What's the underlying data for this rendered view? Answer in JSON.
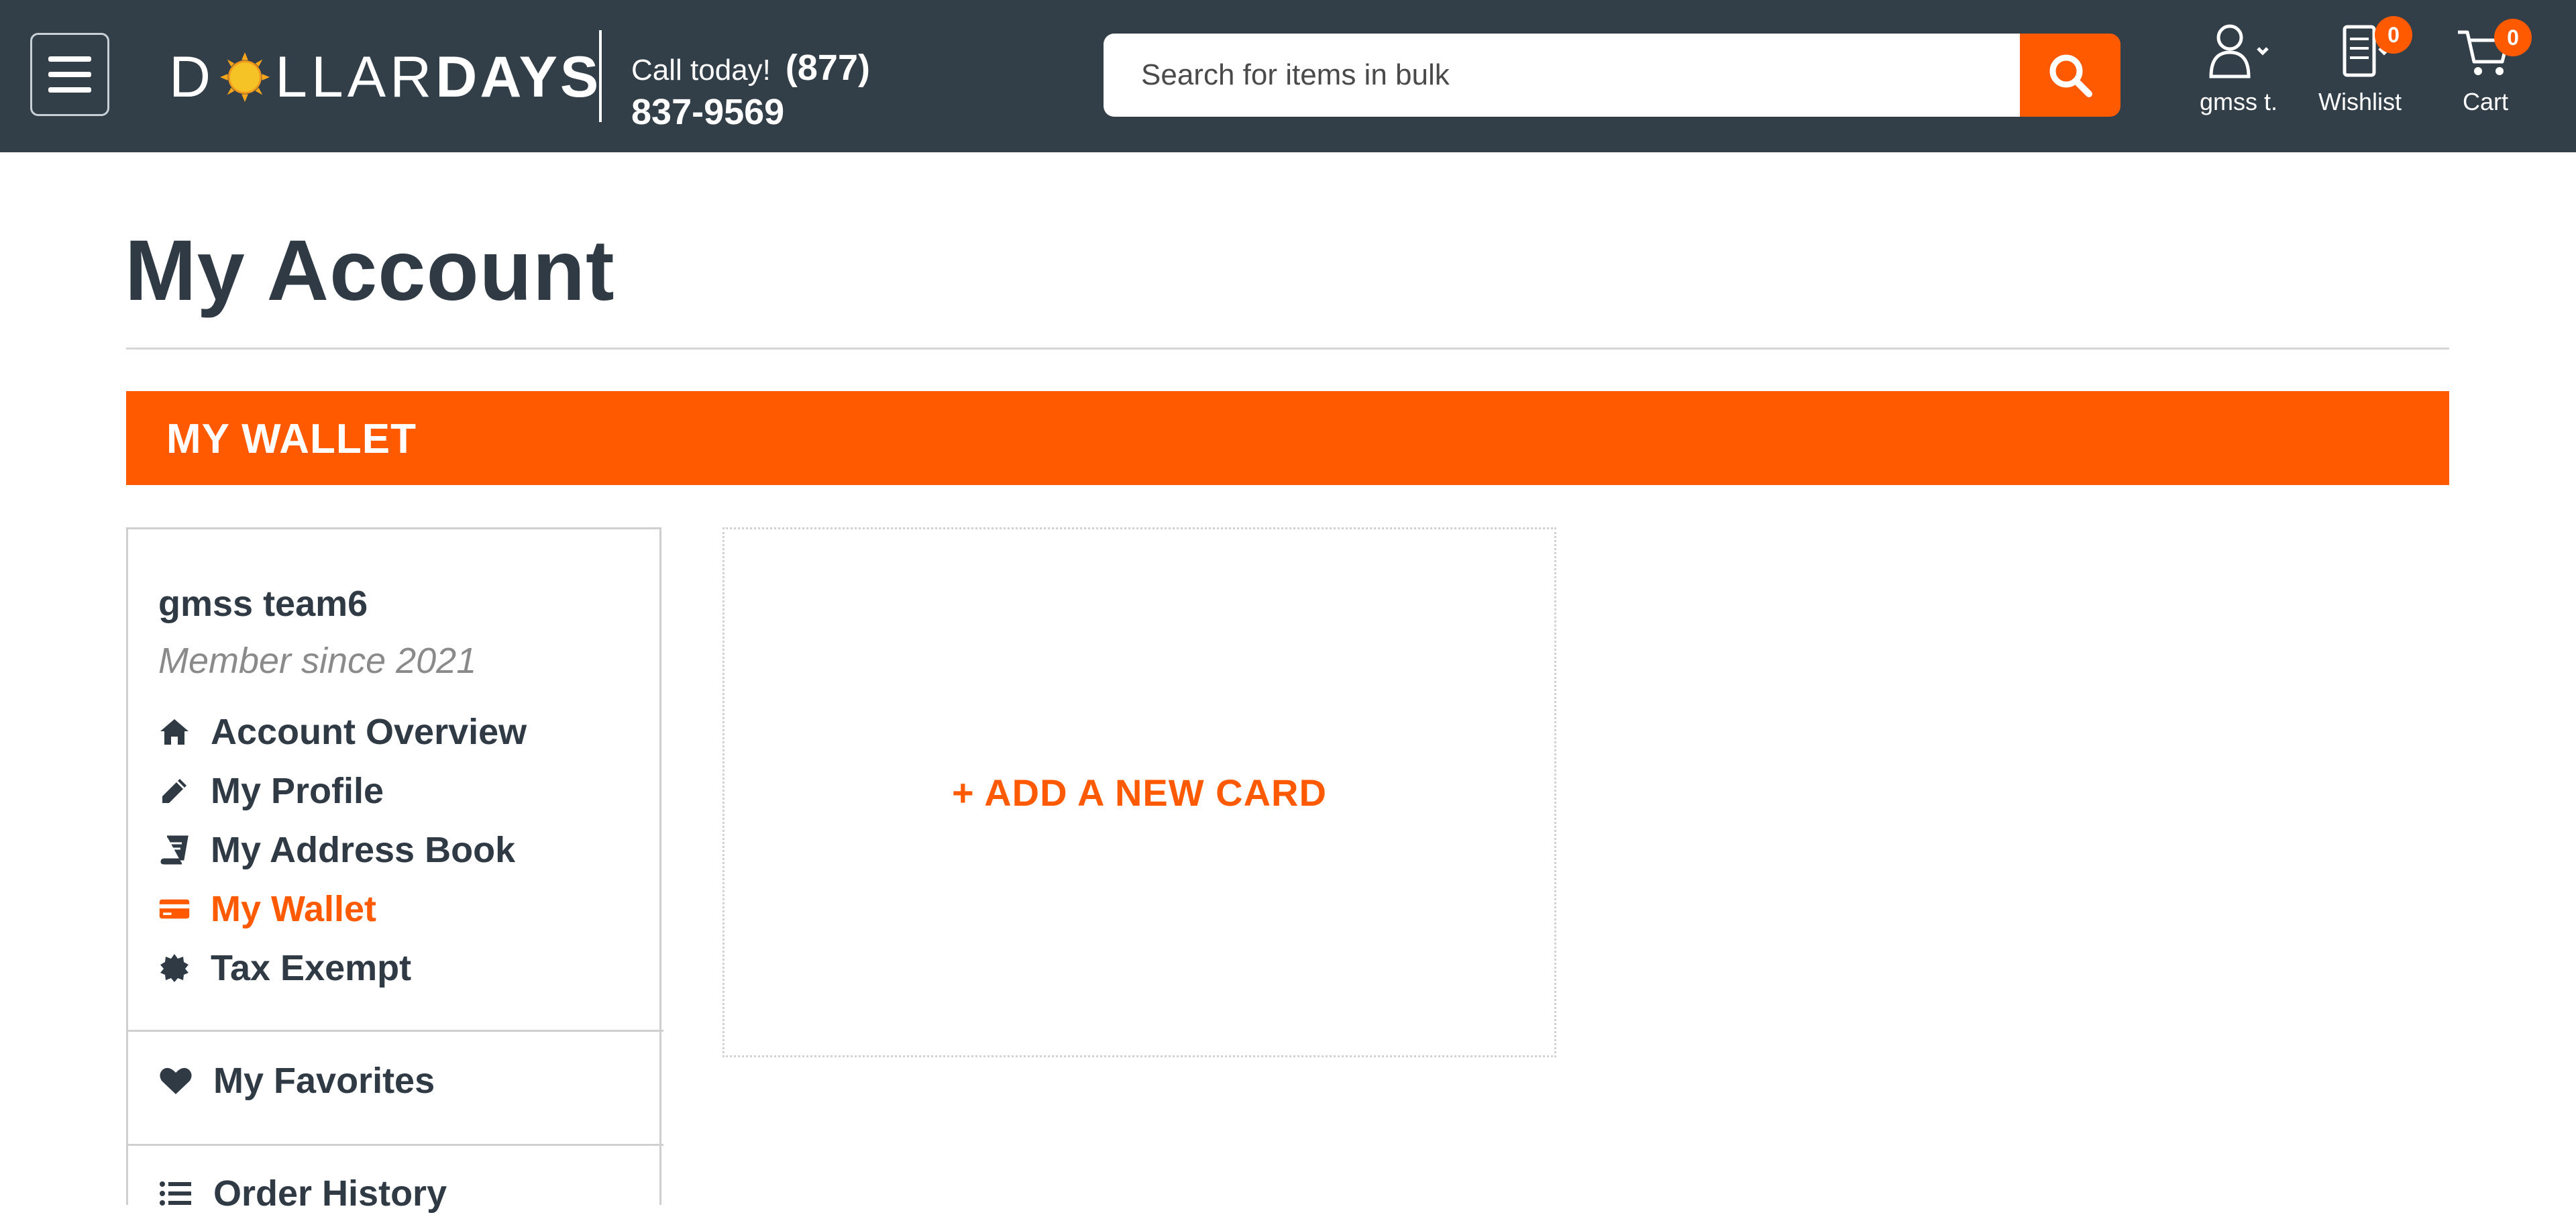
{
  "header": {
    "menu_icon": "hamburger-icon",
    "logo": {
      "part1": "D",
      "part2": "LLAR",
      "part3": "DAYS",
      "sun_icon": "sun-icon"
    },
    "call_label": "Call today!",
    "phone_area": "(877)",
    "phone_number": "837-9569",
    "search": {
      "placeholder": "Search for items in bulk",
      "value": "",
      "icon": "search-icon"
    },
    "user": {
      "label": "gmss t.",
      "icon": "user-icon"
    },
    "wishlist": {
      "label": "Wishlist",
      "count": "0",
      "icon": "wishlist-icon"
    },
    "cart": {
      "label": "Cart",
      "count": "0",
      "icon": "cart-icon"
    }
  },
  "main": {
    "title": "My Account",
    "section_title": "MY WALLET",
    "add_card_label": "+ ADD A NEW CARD"
  },
  "sidebar": {
    "user_name": "gmss team6",
    "member_since": "Member since 2021",
    "items": [
      {
        "label": "Account Overview",
        "icon": "home-icon"
      },
      {
        "label": "My Profile",
        "icon": "pencil-icon"
      },
      {
        "label": "My Address Book",
        "icon": "book-icon"
      },
      {
        "label": "My Wallet",
        "icon": "credit-card-icon",
        "active": true
      },
      {
        "label": "Tax Exempt",
        "icon": "badge-icon"
      }
    ],
    "favorites": {
      "label": "My Favorites",
      "icon": "heart-icon"
    },
    "order_history": {
      "label": "Order History",
      "icon": "list-icon"
    }
  },
  "colors": {
    "accent": "#ff5a00",
    "header_bg": "#333f48",
    "text": "#2f3a45"
  }
}
